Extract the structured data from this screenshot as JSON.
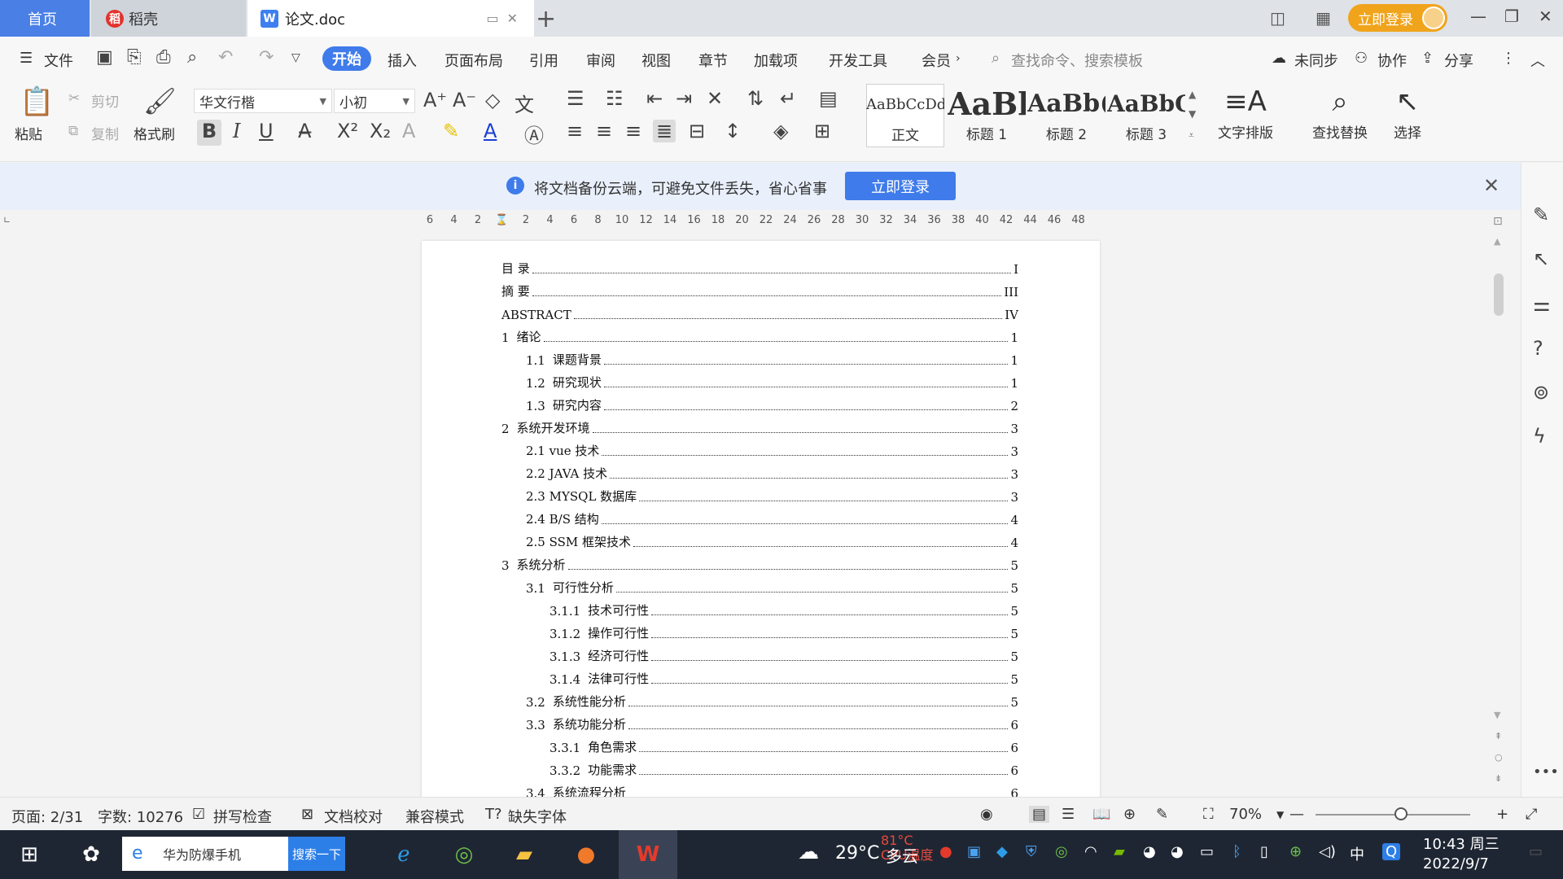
{
  "titlebar": {
    "home_tab": "首页",
    "daoke_tab": "稻壳",
    "doc_tab": "论文.doc",
    "login": "立即登录"
  },
  "menu": {
    "file": "文件",
    "tabs": [
      "开始",
      "插入",
      "页面布局",
      "引用",
      "审阅",
      "视图",
      "章节",
      "加载项",
      "开发工具",
      "会员"
    ],
    "search_placeholder": "查找命令、搜索模板",
    "unsync": "未同步",
    "collab": "协作",
    "share": "分享"
  },
  "ribbon": {
    "paste": "粘贴",
    "cut": "剪切",
    "copy": "复制",
    "format_painter": "格式刷",
    "font_name": "华文行楷",
    "font_size": "小初",
    "styles": [
      {
        "sample": "AaBbCcDd",
        "name": "正文"
      },
      {
        "sample": "AaBl",
        "name": "标题 1"
      },
      {
        "sample": "AaBb(",
        "name": "标题 2"
      },
      {
        "sample": "AaBbC",
        "name": "标题 3"
      }
    ],
    "text_layout": "文字排版",
    "find_replace": "查找替换",
    "select": "选择"
  },
  "notice": {
    "text": "将文档备份云端，可避免文件丢失，省心省事",
    "button": "立即登录"
  },
  "ruler": {
    "ticks": [
      "6",
      "4",
      "2",
      "",
      "2",
      "4",
      "6",
      "8",
      "10",
      "12",
      "14",
      "16",
      "18",
      "20",
      "22",
      "24",
      "26",
      "28",
      "30",
      "32",
      "34",
      "36",
      "38",
      "40",
      "42",
      "44",
      "46",
      "48"
    ]
  },
  "toc": [
    {
      "level": 1,
      "num": "",
      "title": "目  录",
      "page": "I"
    },
    {
      "level": 1,
      "num": "",
      "title": "摘    要",
      "page": "III"
    },
    {
      "level": 1,
      "num": "",
      "title": "ABSTRACT",
      "page": "IV"
    },
    {
      "level": 1,
      "num": "1",
      "title": "绪论",
      "page": "1"
    },
    {
      "level": 2,
      "num": "1.1",
      "title": "课题背景",
      "page": "1"
    },
    {
      "level": 2,
      "num": "1.2",
      "title": "研究现状",
      "page": "1"
    },
    {
      "level": 2,
      "num": "1.3",
      "title": "研究内容",
      "page": "2"
    },
    {
      "level": 1,
      "num": "2",
      "title": "系统开发环境",
      "page": "3"
    },
    {
      "level": 2,
      "num": "",
      "title": "2.1 vue 技术",
      "page": "3"
    },
    {
      "level": 2,
      "num": "",
      "title": "2.2 JAVA 技术",
      "page": "3"
    },
    {
      "level": 2,
      "num": "",
      "title": "2.3 MYSQL 数据库",
      "page": "3"
    },
    {
      "level": 2,
      "num": "",
      "title": "2.4 B/S 结构",
      "page": "4"
    },
    {
      "level": 2,
      "num": "",
      "title": "2.5 SSM 框架技术",
      "page": "4"
    },
    {
      "level": 1,
      "num": "3",
      "title": "系统分析",
      "page": "5"
    },
    {
      "level": 2,
      "num": "3.1",
      "title": "可行性分析",
      "page": "5"
    },
    {
      "level": 3,
      "num": "3.1.1",
      "title": "技术可行性",
      "page": "5"
    },
    {
      "level": 3,
      "num": "3.1.2",
      "title": "操作可行性",
      "page": "5"
    },
    {
      "level": 3,
      "num": "3.1.3",
      "title": "经济可行性",
      "page": "5"
    },
    {
      "level": 3,
      "num": "3.1.4",
      "title": "法律可行性",
      "page": "5"
    },
    {
      "level": 2,
      "num": "3.2",
      "title": "系统性能分析",
      "page": "5"
    },
    {
      "level": 2,
      "num": "3.3",
      "title": "系统功能分析",
      "page": "6"
    },
    {
      "level": 3,
      "num": "3.3.1",
      "title": "角色需求",
      "page": "6"
    },
    {
      "level": 3,
      "num": "3.3.2",
      "title": "功能需求",
      "page": "6"
    },
    {
      "level": 2,
      "num": "3.4",
      "title": "系统流程分析",
      "page": "6"
    }
  ],
  "status": {
    "page": "页面: 2/31",
    "words": "字数: 10276",
    "spell": "拼写检查",
    "proof": "文档校对",
    "compat": "兼容模式",
    "missing_font": "缺失字体",
    "zoom": "70%",
    "zoom_level": 0.55
  },
  "taskbar": {
    "search_text": "华为防爆手机",
    "search_btn": "搜索一下",
    "temp": "29°C",
    "weather": "多云",
    "cpu_temp": "81°C",
    "cpu_label": "CPU温度",
    "ime": "中",
    "time": "10:43 周三",
    "date": "2022/9/7"
  },
  "colors": {
    "accent": "#3f7bea",
    "login_pill": "#f0a41c"
  }
}
